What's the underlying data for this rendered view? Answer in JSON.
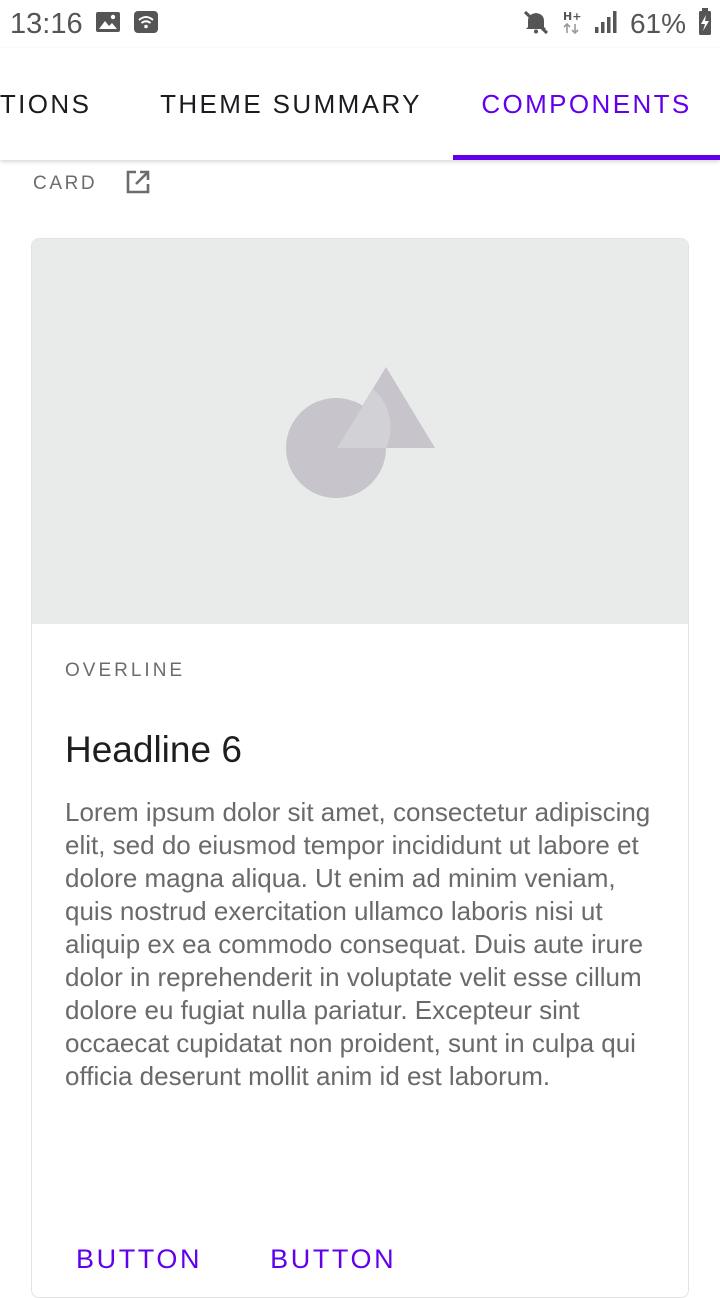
{
  "status_bar": {
    "time": "13:16",
    "battery_percent": "61%",
    "icons": [
      "image-icon",
      "wifi-icon",
      "mute-icon",
      "hplus-icon",
      "signal-icon",
      "battery-charging-icon"
    ]
  },
  "tabs": [
    {
      "label": "CTIONS",
      "selected": false
    },
    {
      "label": "THEME SUMMARY",
      "selected": false
    },
    {
      "label": "COMPONENTS",
      "selected": true
    }
  ],
  "accent_color": "#6200ee",
  "section": {
    "label": "CARD",
    "link_icon": "open-in-new-icon"
  },
  "card": {
    "media_icon": "shapes-placeholder-icon",
    "overline": "OVERLINE",
    "headline": "Headline 6",
    "body": "Lorem ipsum dolor sit amet, consectetur adipiscing elit, sed do eiusmod tempor incididunt ut labore et dolore magna aliqua. Ut enim ad minim veniam, quis nostrud exercitation ullamco laboris nisi ut aliquip ex ea commodo consequat. Duis aute irure dolor in reprehenderit in voluptate velit esse cillum dolore eu fugiat nulla pariatur. Excepteur sint occaecat cupidatat non proident, sunt in culpa qui officia deserunt mollit anim id est laborum.",
    "actions": [
      {
        "label": "BUTTON"
      },
      {
        "label": "BUTTON"
      }
    ]
  }
}
